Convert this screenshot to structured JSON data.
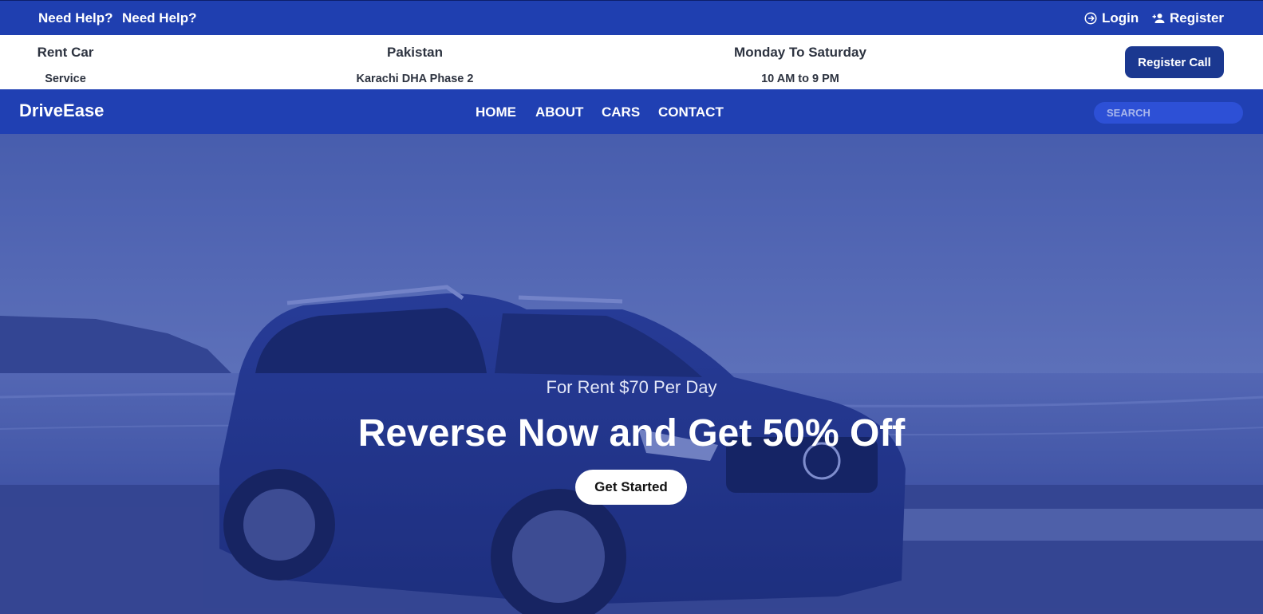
{
  "topbar": {
    "help_1": "Need Help?",
    "help_2": "Need Help?",
    "login_label": "Login",
    "register_label": "Register",
    "login_icon": "login-icon",
    "register_icon": "person-add-icon"
  },
  "info": [
    {
      "title": "Rent Car",
      "subtitle": "Service"
    },
    {
      "title": "Pakistan",
      "subtitle": "Karachi DHA Phase 2"
    },
    {
      "title": "Monday To Saturday",
      "subtitle": "10 AM to 9 PM"
    }
  ],
  "register_call_label": "Register Call",
  "navbar": {
    "brand": "DriveEase",
    "links": [
      "HOME",
      "ABOUT",
      "CARS",
      "CONTACT"
    ],
    "search_placeholder": "SEARCH"
  },
  "hero": {
    "subtitle": "For Rent $70 Per Day",
    "title": "Reverse Now and Get 50% Off",
    "cta_label": "Get Started"
  },
  "colors": {
    "topbar": "#1f3fb0",
    "navbar": "#2040b3",
    "register_call_button": "#1b3890",
    "search_bg": "#2d50d6"
  }
}
